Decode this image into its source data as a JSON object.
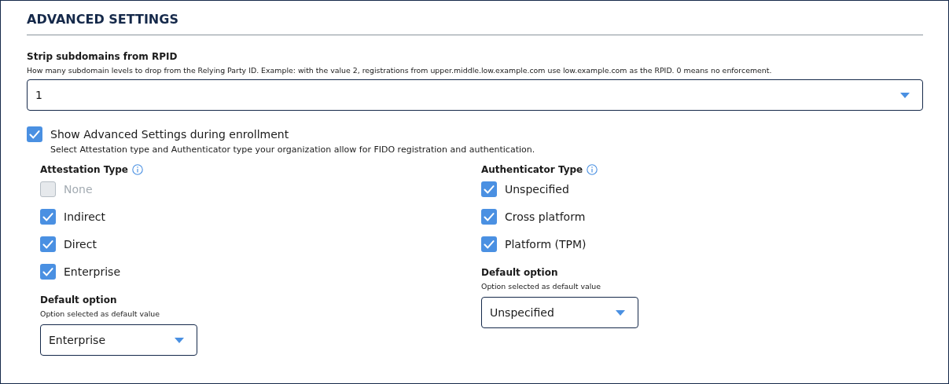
{
  "section": {
    "title": "ADVANCED SETTINGS"
  },
  "strip_field": {
    "label": "Strip subdomains from RPID",
    "description": "How many subdomain levels to drop from the Relying Party ID. Example: with the value 2, registrations from upper.middle.low.example.com use low.example.com as the RPID. 0 means no enforcement.",
    "value": "1"
  },
  "show_advanced": {
    "label": "Show Advanced Settings during enrollment",
    "description": "Select Attestation type and Authenticator type your organization allow for FIDO registration and authentication.",
    "checked": true
  },
  "groups": [
    {
      "title": "Attestation Type",
      "options": [
        {
          "label": "None",
          "checked": false,
          "disabled": true
        },
        {
          "label": "Indirect",
          "checked": true,
          "disabled": false
        },
        {
          "label": "Direct",
          "checked": true,
          "disabled": false
        },
        {
          "label": "Enterprise",
          "checked": true,
          "disabled": false
        }
      ],
      "default_label": "Default option",
      "default_description": "Option selected as default value",
      "default_value": "Enterprise"
    },
    {
      "title": "Authenticator Type",
      "options": [
        {
          "label": "Unspecified",
          "checked": true,
          "disabled": false
        },
        {
          "label": "Cross platform",
          "checked": true,
          "disabled": false
        },
        {
          "label": "Platform (TPM)",
          "checked": true,
          "disabled": false
        }
      ],
      "default_label": "Default option",
      "default_description": "Option selected as default value",
      "default_value": "Unspecified"
    }
  ]
}
